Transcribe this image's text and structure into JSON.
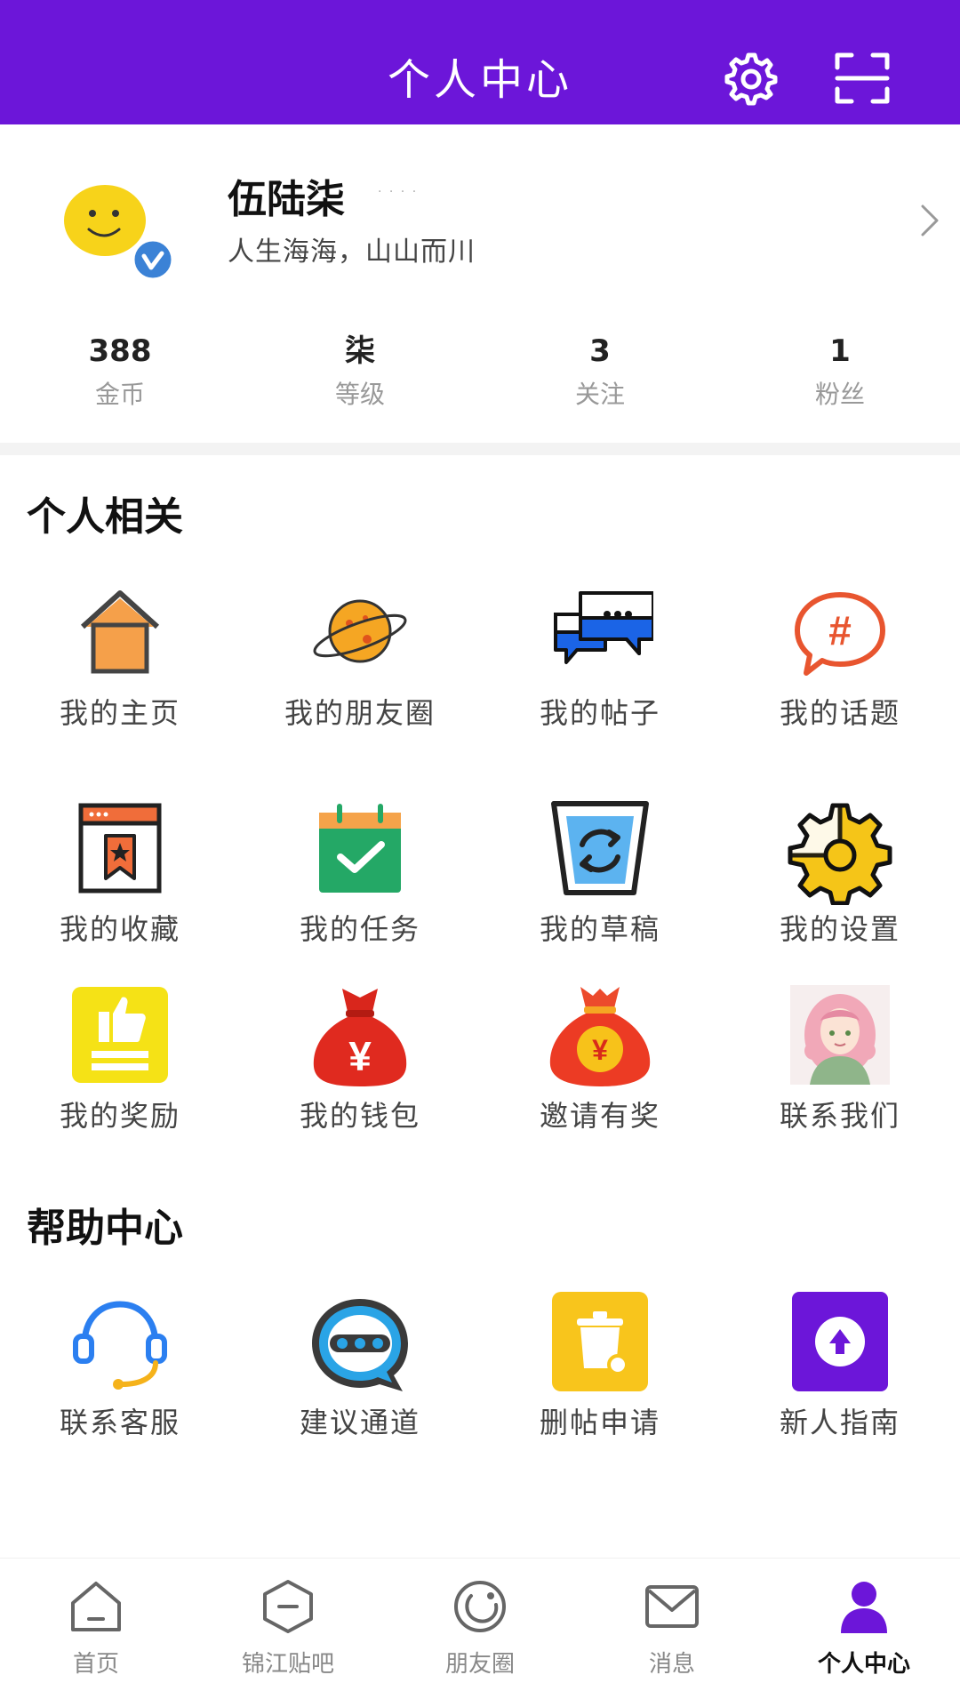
{
  "header": {
    "title": "个人中心"
  },
  "profile": {
    "name": "伍陆柒",
    "bio": "人生海海，山山而川"
  },
  "stats": [
    {
      "value": "388",
      "label": "金币"
    },
    {
      "value": "柒",
      "label": "等级"
    },
    {
      "value": "3",
      "label": "关注"
    },
    {
      "value": "1",
      "label": "粉丝"
    }
  ],
  "personal": {
    "title": "个人相关",
    "items": [
      {
        "label": "我的主页",
        "icon": "home-icon"
      },
      {
        "label": "我的朋友圈",
        "icon": "planet-icon"
      },
      {
        "label": "我的帖子",
        "icon": "chat-bubbles-icon"
      },
      {
        "label": "我的话题",
        "icon": "hashtag-icon"
      },
      {
        "label": "我的收藏",
        "icon": "bookmark-window-icon"
      },
      {
        "label": "我的任务",
        "icon": "calendar-check-icon"
      },
      {
        "label": "我的草稿",
        "icon": "recycle-bin-icon"
      },
      {
        "label": "我的设置",
        "icon": "gear-icon"
      },
      {
        "label": "我的奖励",
        "icon": "thumbs-up-icon"
      },
      {
        "label": "我的钱包",
        "icon": "money-bag-icon"
      },
      {
        "label": "邀请有奖",
        "icon": "lucky-bag-icon"
      },
      {
        "label": "联系我们",
        "icon": "portrait-avatar-icon"
      }
    ]
  },
  "help": {
    "title": "帮助中心",
    "items": [
      {
        "label": "联系客服",
        "icon": "headset-icon"
      },
      {
        "label": "建议通道",
        "icon": "message-dots-icon"
      },
      {
        "label": "删帖申请",
        "icon": "trash-icon"
      },
      {
        "label": "新人指南",
        "icon": "upload-arrow-icon"
      }
    ]
  },
  "bottom_nav": [
    {
      "label": "首页",
      "icon": "home-outline-icon",
      "active": false
    },
    {
      "label": "锦江贴吧",
      "icon": "hexagon-icon",
      "active": false
    },
    {
      "label": "朋友圈",
      "icon": "circle-ring-icon",
      "active": false
    },
    {
      "label": "消息",
      "icon": "mail-icon",
      "active": false
    },
    {
      "label": "个人中心",
      "icon": "person-icon",
      "active": true
    }
  ],
  "colors": {
    "primary": "#6c16d9",
    "verified": "#3b82d6",
    "text": "#1a1a1a",
    "muted": "#999999"
  }
}
